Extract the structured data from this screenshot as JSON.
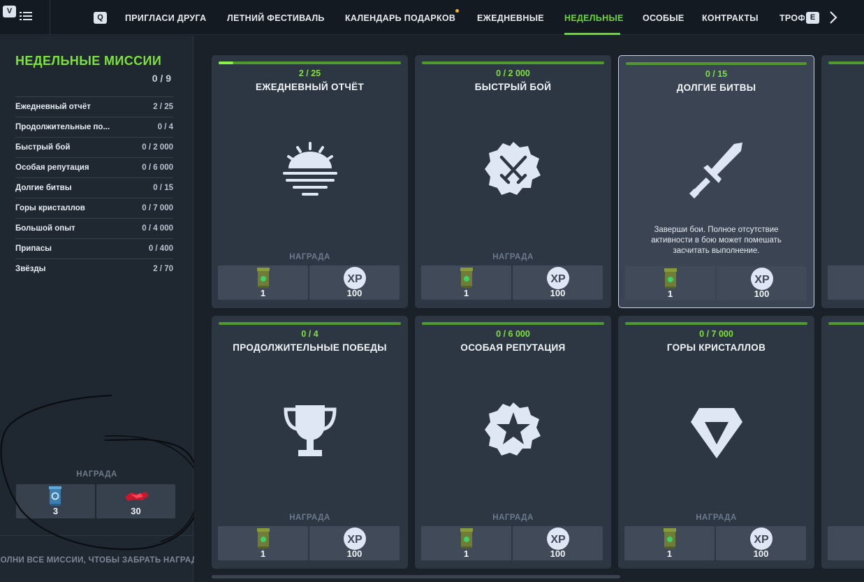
{
  "nav": {
    "key_v": "V",
    "key_q": "Q",
    "key_e": "E",
    "tabs": [
      {
        "label": "ПРИГЛАСИ ДРУГА"
      },
      {
        "label": "ЛЕТНИЙ ФЕСТИВАЛЬ"
      },
      {
        "label": "КАЛЕНДАРЬ ПОДАРКОВ"
      },
      {
        "label": "ЕЖЕДНЕВНЫЕ"
      },
      {
        "label": "НЕДЕЛЬНЫЕ"
      },
      {
        "label": "ОСОБЫЕ"
      },
      {
        "label": "КОНТРАКТЫ"
      },
      {
        "label": "ТРОФ"
      }
    ],
    "active_tab": "НЕДЕЛЬНЫЕ",
    "accent_color": "#68d82c",
    "notification_color": "#f0b429"
  },
  "sidebar": {
    "title": "НЕДЕЛЬНЫЕ МИССИИ",
    "progress": "0 / 9",
    "missions": [
      {
        "name": "Ежедневный отчёт",
        "value": "2 / 25"
      },
      {
        "name": "Продолжительные по...",
        "value": "0 / 4"
      },
      {
        "name": "Быстрый бой",
        "value": "0 / 2 000"
      },
      {
        "name": "Особая репутация",
        "value": "0 / 6 000"
      },
      {
        "name": "Долгие битвы",
        "value": "0 / 15"
      },
      {
        "name": "Горы кристаллов",
        "value": "0 / 7 000"
      },
      {
        "name": "Большой опыт",
        "value": "0 / 4 000"
      },
      {
        "name": "Припасы",
        "value": "0 / 400"
      },
      {
        "name": "Звёзды",
        "value": "2 / 70"
      }
    ],
    "reward_label": "НАГРАДА",
    "rewards": [
      {
        "icon": "container-icon",
        "count": "3"
      },
      {
        "icon": "ruby-icon",
        "count": "30"
      }
    ],
    "footer": "ПОЛНИ ВСЕ МИССИИ, ЧТОБЫ ЗАБРАТЬ НАГРАДЫ"
  },
  "cards": [
    {
      "title": "ЕЖЕДНЕВНЫЙ ОТЧЁТ",
      "progress": "2 / 25",
      "progress_fraction": 0.08,
      "icon": "sunrise-icon",
      "description": "",
      "reward_label": "НАГРАДА",
      "reward_1": "1",
      "reward_2": "100"
    },
    {
      "title": "БЫСТРЫЙ БОЙ",
      "progress": "0 / 2 000",
      "progress_fraction": 0,
      "icon": "crossed-swords-icon",
      "description": "",
      "reward_label": "НАГРАДА",
      "reward_1": "1",
      "reward_2": "100"
    },
    {
      "title": "ДОЛГИЕ БИТВЫ",
      "progress": "0 / 15",
      "progress_fraction": 0,
      "icon": "sword-icon",
      "description": "Заверши бои. Полное отсутствие активности в бою может помешать засчитать выполнение.",
      "reward_label": "",
      "reward_1": "1",
      "reward_2": "100"
    },
    {
      "title": "ПРОДОЛЖИТЕЛЬНЫЕ ПОБЕДЫ",
      "progress": "0 / 4",
      "progress_fraction": 0,
      "icon": "trophy-icon",
      "description": "",
      "reward_label": "НАГРАДА",
      "reward_1": "1",
      "reward_2": "100"
    },
    {
      "title": "ОСОБАЯ РЕПУТАЦИЯ",
      "progress": "0 / 6 000",
      "progress_fraction": 0,
      "icon": "star-badge-icon",
      "description": "",
      "reward_label": "НАГРАДА",
      "reward_1": "1",
      "reward_2": "100"
    },
    {
      "title": "ГОРЫ КРИСТАЛЛОВ",
      "progress": "0 / 7 000",
      "progress_fraction": 0,
      "icon": "crystal-icon",
      "description": "",
      "reward_label": "НАГРАДА",
      "reward_1": "1",
      "reward_2": "100"
    }
  ],
  "xp_badge_text": "XP"
}
